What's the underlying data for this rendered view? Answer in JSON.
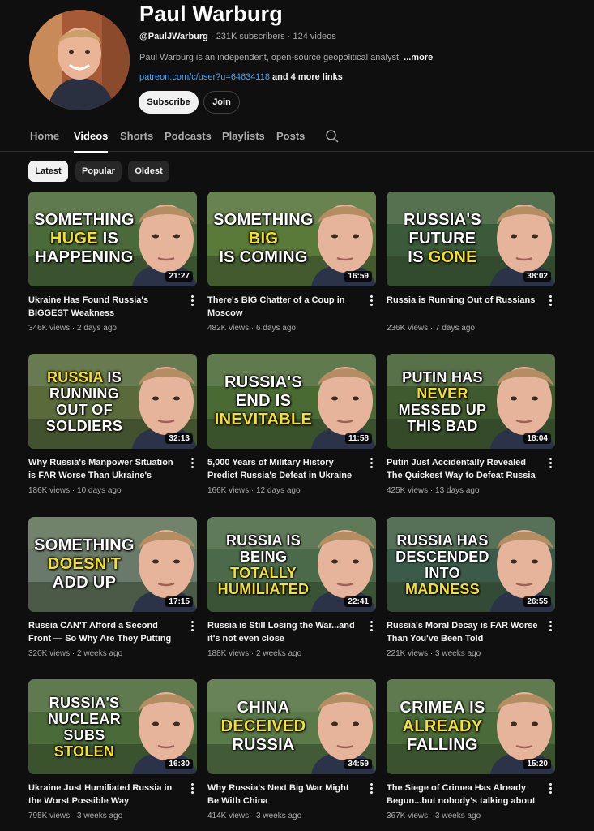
{
  "channel": {
    "name": "Paul Warburg",
    "handle": "@PaulJWarburg",
    "subscribers": "231K subscribers",
    "videos_count": "124 videos",
    "description": "Paul Warburg is an independent, open-source geopolitical analyst.",
    "more_label": "...more",
    "link": "patreon.com/c/user?u=64634118",
    "more_links": "and 4 more links",
    "subscribe_label": "Subscribe",
    "join_label": "Join"
  },
  "tabs": [
    {
      "label": "Home",
      "active": false
    },
    {
      "label": "Videos",
      "active": true
    },
    {
      "label": "Shorts",
      "active": false
    },
    {
      "label": "Podcasts",
      "active": false
    },
    {
      "label": "Playlists",
      "active": false
    },
    {
      "label": "Posts",
      "active": false
    }
  ],
  "filters": [
    {
      "label": "Latest",
      "active": true
    },
    {
      "label": "Popular",
      "active": false
    },
    {
      "label": "Oldest",
      "active": false
    }
  ],
  "videos": [
    {
      "thumb_lines": [
        "SOMETHING",
        "*HUGE* IS",
        "HAPPENING"
      ],
      "duration": "21:27",
      "title": "Ukraine Has Found Russia's BIGGEST Weakness",
      "views": "346K views",
      "age": "2 days ago",
      "bg": "#4a6a3a"
    },
    {
      "thumb_lines": [
        "SOMETHING",
        "*BIG*",
        "IS COMING"
      ],
      "duration": "16:59",
      "title": "There's BIG Chatter of a Coup in Moscow",
      "views": "482K views",
      "age": "6 days ago",
      "bg": "#5a7a3a"
    },
    {
      "thumb_lines": [
        "RUSSIA'S",
        "FUTURE",
        "IS *GONE*"
      ],
      "duration": "38:02",
      "title": "Russia is Running Out of Russians",
      "views": "236K views",
      "age": "7 days ago",
      "bg": "#3a5a3a"
    },
    {
      "thumb_lines": [
        "*RUSSIA* IS",
        "RUNNING",
        "OUT OF",
        "SOLDIERS"
      ],
      "duration": "32:13",
      "title": "Why Russia's Manpower Situation is FAR Worse Than Ukraine's",
      "views": "186K views",
      "age": "10 days ago",
      "bg": "#5a6a3a"
    },
    {
      "thumb_lines": [
        "RUSSIA'S",
        "END IS",
        "*INEVITABLE*"
      ],
      "duration": "11:58",
      "title": "5,000 Years of Military History Predict Russia's Defeat in Ukraine",
      "views": "166K views",
      "age": "12 days ago",
      "bg": "#4a6a34"
    },
    {
      "thumb_lines": [
        "PUTIN HAS",
        "*NEVER*",
        "MESSED UP",
        "THIS BAD"
      ],
      "duration": "18:04",
      "title": "Putin Just Accidentally Revealed The Quickest Way to Defeat Russia",
      "views": "425K views",
      "age": "13 days ago",
      "bg": "#3f5a2e"
    },
    {
      "thumb_lines": [
        "SOMETHING",
        "*DOESN'T*",
        "ADD UP"
      ],
      "duration": "17:15",
      "title": "Russia CAN'T Afford a Second Front — So Why Are They Putting Troops on...",
      "views": "320K views",
      "age": "2 weeks ago",
      "bg": "#6a7a6a"
    },
    {
      "thumb_lines": [
        "RUSSIA IS",
        "BEING",
        "*TOTALLY*",
        "*HUMILIATED*"
      ],
      "duration": "22:41",
      "title": "Russia is Still Losing the War...and it's not even close",
      "views": "188K views",
      "age": "2 weeks ago",
      "bg": "#4a6a4a"
    },
    {
      "thumb_lines": [
        "RUSSIA HAS",
        "DESCENDED",
        "INTO",
        "*MADNESS*"
      ],
      "duration": "26:55",
      "title": "Russia's Moral Decay is FAR Worse Than You've Been Told",
      "views": "221K views",
      "age": "3 weeks ago",
      "bg": "#3a5a4a"
    },
    {
      "thumb_lines": [
        "RUSSIA'S",
        "NUCLEAR",
        "SUBS",
        "*STOLEN*"
      ],
      "duration": "16:30",
      "title": "Ukraine Just Humiliated Russia in the Worst Possible Way",
      "views": "795K views",
      "age": "3 weeks ago",
      "bg": "#4a6a3a"
    },
    {
      "thumb_lines": [
        "CHINA",
        "*DECEIVED*",
        "RUSSIA"
      ],
      "duration": "34:59",
      "title": "Why Russia's Next Big War Might Be With China",
      "views": "414K views",
      "age": "3 weeks ago",
      "bg": "#5a7a4a"
    },
    {
      "thumb_lines": [
        "CRIMEA IS",
        "*ALREADY*",
        "FALLING"
      ],
      "duration": "15:20",
      "title": "The Siege of Crimea Has Already Begun...but nobody's talking about it",
      "views": "367K views",
      "age": "3 weeks ago",
      "bg": "#4a6a3a"
    }
  ]
}
